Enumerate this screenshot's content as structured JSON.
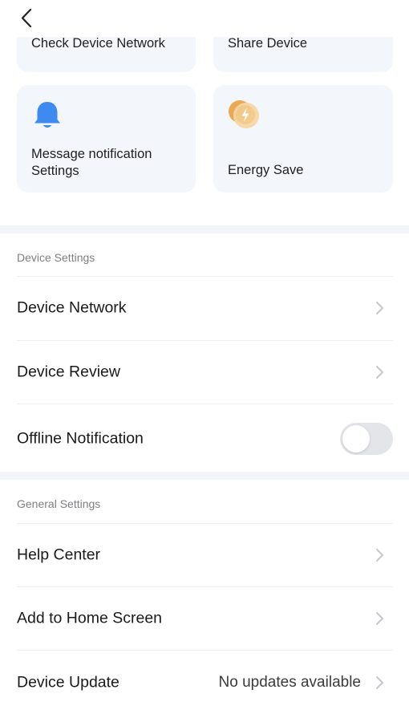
{
  "nav": {
    "back_icon": "chevron-left-icon"
  },
  "cards": {
    "check_network": "Check Device Network",
    "share_device": "Share Device",
    "message_notification": "Message notification Settings",
    "energy_save": "Energy Save",
    "bell_icon": "bell-icon",
    "energy_icon": "lightning-bolt-icon"
  },
  "device_settings": {
    "title": "Device Settings",
    "items": [
      {
        "label": "Device Network"
      },
      {
        "label": "Device Review"
      },
      {
        "label": "Offline Notification",
        "toggle_on": false
      }
    ]
  },
  "general_settings": {
    "title": "General Settings",
    "items": [
      {
        "label": "Help Center"
      },
      {
        "label": "Add to Home Screen"
      },
      {
        "label": "Device Update",
        "value": "No updates available"
      }
    ]
  },
  "colors": {
    "accent_blue": "#3d8bf0",
    "energy_orange": "#e8a23e",
    "card_bg": "#f3f6fa"
  }
}
